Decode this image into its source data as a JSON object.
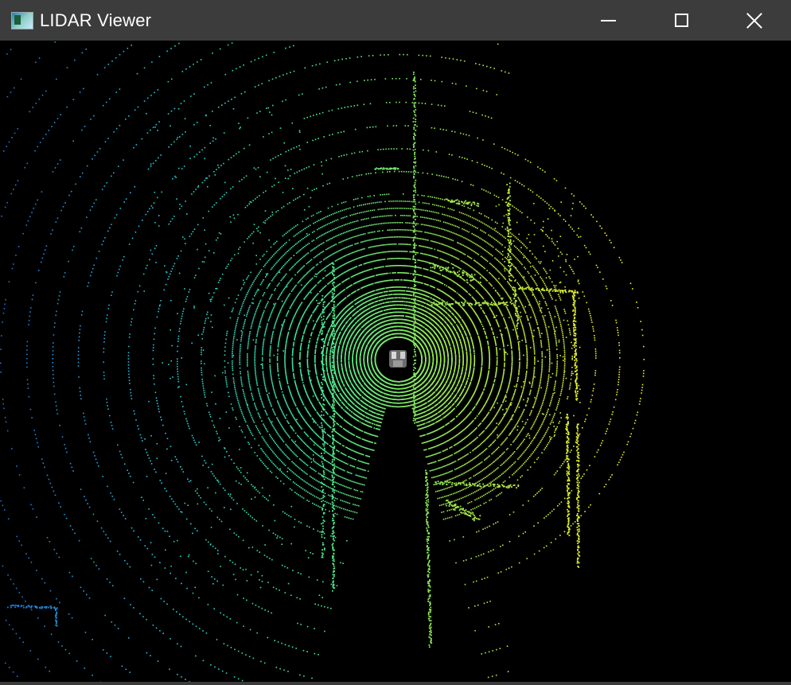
{
  "window": {
    "title": "LIDAR Viewer",
    "icon": "app-icon",
    "controls": [
      "minimize-icon",
      "maximize-icon",
      "close-icon"
    ]
  },
  "viewer": {
    "background": "#000000",
    "colormap": [
      "#1e6fd6",
      "#20c8e0",
      "#3ee89a",
      "#9ee84a",
      "#f0f020"
    ],
    "vehicle_icon": "car-icon"
  }
}
